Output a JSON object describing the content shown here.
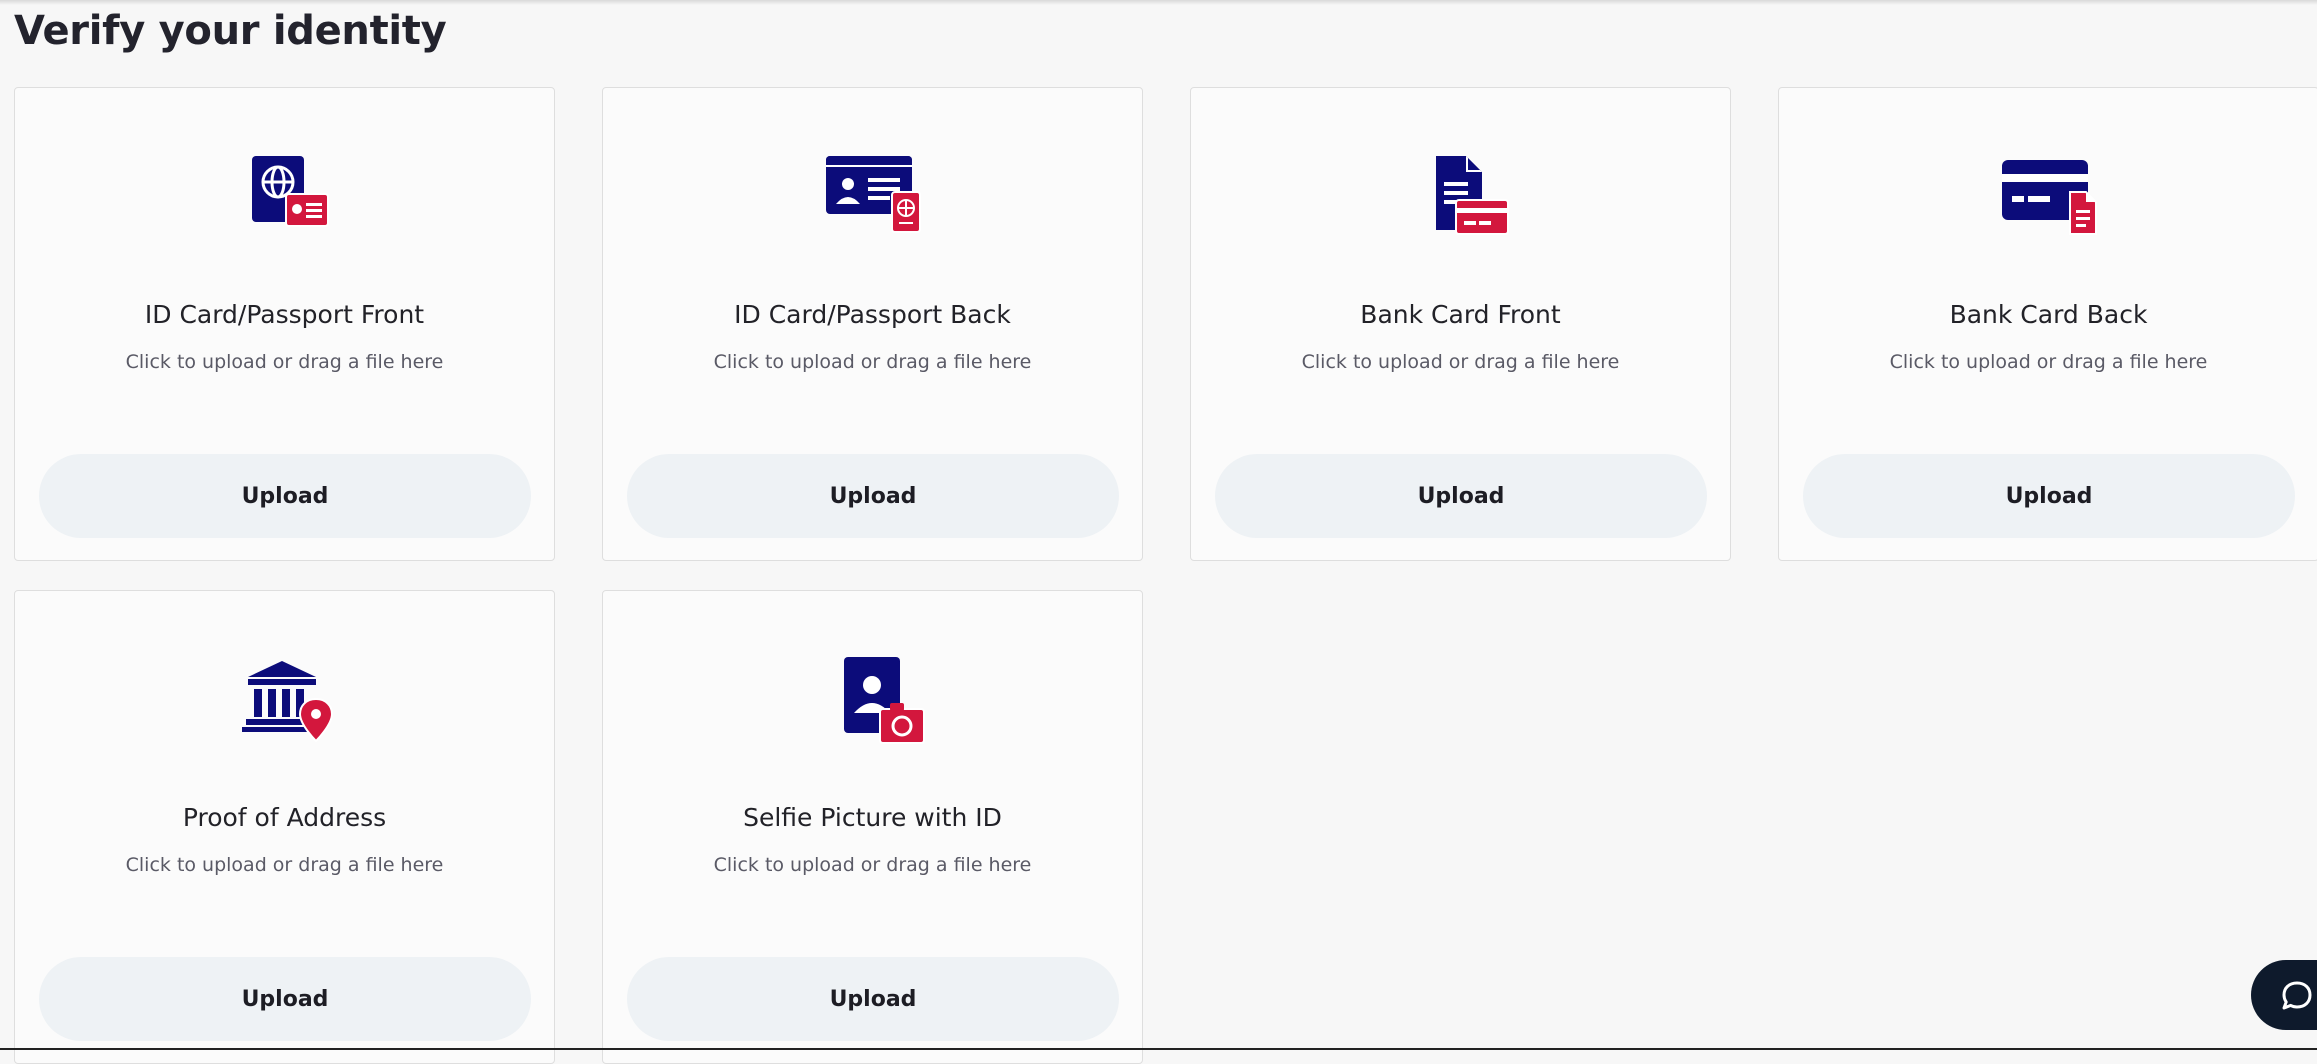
{
  "page": {
    "title": "Verify your identity"
  },
  "colors": {
    "navy": "#0c0c7a",
    "crimson": "#d3173d",
    "button_bg": "#eef2f5"
  },
  "cards": [
    {
      "title": "ID Card/Passport Front",
      "hint": "Click to upload or drag a file here",
      "button": "Upload",
      "icon": "passport-front-icon"
    },
    {
      "title": "ID Card/Passport Back",
      "hint": "Click to upload or drag a file here",
      "button": "Upload",
      "icon": "id-card-back-icon"
    },
    {
      "title": "Bank Card Front",
      "hint": "Click to upload or drag a file here",
      "button": "Upload",
      "icon": "bank-card-front-icon"
    },
    {
      "title": "Bank Card Back",
      "hint": "Click to upload or drag a file here",
      "button": "Upload",
      "icon": "bank-card-back-icon"
    },
    {
      "title": "Proof of Address",
      "hint": "Click to upload or drag a file here",
      "button": "Upload",
      "icon": "bank-location-icon"
    },
    {
      "title": "Selfie Picture with ID",
      "hint": "Click to upload or drag a file here",
      "button": "Upload",
      "icon": "selfie-camera-icon"
    }
  ],
  "chat": {
    "icon": "chat-bubble-icon"
  }
}
